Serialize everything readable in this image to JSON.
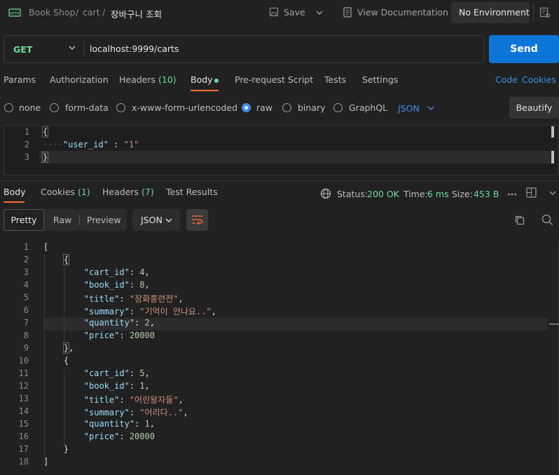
{
  "breadcrumb": {
    "collection": "Book Shop",
    "sep1": "/",
    "folder": "cart",
    "sep2": "/",
    "request": "장바구니 조회"
  },
  "toolbar": {
    "save_label": "Save",
    "docs_label": "View Documentation",
    "environment": "No Environment"
  },
  "request": {
    "method": "GET",
    "url": "localhost:9999/carts",
    "send_label": "Send"
  },
  "request_tabs": {
    "params": "Params",
    "authorization": "Authorization",
    "headers": "Headers",
    "headers_count": "(10)",
    "body": "Body",
    "prerequest": "Pre-request Script",
    "tests": "Tests",
    "settings": "Settings",
    "code": "Code",
    "cookies": "Cookies"
  },
  "body_types": {
    "none": "none",
    "form_data": "form-data",
    "urlencoded": "x-www-form-urlencoded",
    "raw": "raw",
    "binary": "binary",
    "graphql": "GraphQL",
    "selected_format": "JSON",
    "beautify_label": "Beautify"
  },
  "request_body": {
    "lines": [
      "1",
      "2",
      "3"
    ],
    "open": "{",
    "key": "\"user_id\"",
    "colon": " : ",
    "value": "\"1\"",
    "close": "}"
  },
  "response_tabs": {
    "body": "Body",
    "cookies": "Cookies",
    "cookies_count": "(1)",
    "headers": "Headers",
    "headers_count": "(7)",
    "test_results": "Test Results"
  },
  "response_status": {
    "status_label": "Status:",
    "status_value": "200 OK",
    "time_label": "Time:",
    "time_value": "6 ms",
    "size_label": "Size:",
    "size_value": "453 B"
  },
  "response_view": {
    "pretty": "Pretty",
    "raw": "Raw",
    "preview": "Preview",
    "format": "JSON"
  },
  "response_body": {
    "line_numbers": [
      "1",
      "2",
      "3",
      "4",
      "5",
      "6",
      "7",
      "8",
      "9",
      "10",
      "11",
      "12",
      "13",
      "14",
      "15",
      "16",
      "17",
      "18"
    ],
    "items": [
      {
        "cart_id": "4",
        "book_id": "8",
        "title": "\"장화홍련전\"",
        "summary": "\"기억이 안나요..\"",
        "quantity": "2",
        "price": "20000"
      },
      {
        "cart_id": "5",
        "book_id": "1",
        "title": "\"어린왕자들\"",
        "summary": "\"어리다..\"",
        "quantity": "1",
        "price": "20000"
      }
    ],
    "keys": {
      "cart_id": "\"cart_id\"",
      "book_id": "\"book_id\"",
      "title": "\"title\"",
      "summary": "\"summary\"",
      "quantity": "\"quantity\"",
      "price": "\"price\""
    }
  },
  "colors": {
    "accent": "#ff6c37",
    "send": "#0e75d8",
    "method": "#6bdd9a",
    "link": "#3e8ee8"
  }
}
